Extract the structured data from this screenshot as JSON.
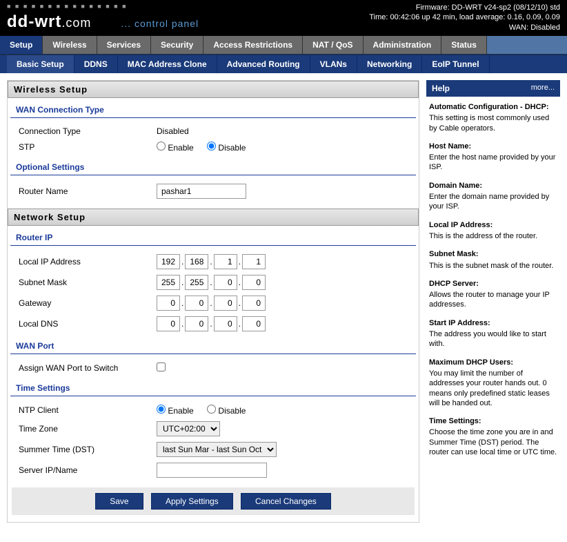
{
  "header": {
    "firmware": "Firmware: DD-WRT v24-sp2 (08/12/10) std",
    "time": "Time: 00:42:06 up 42 min, load average: 0.16, 0.09, 0.09",
    "wan": "WAN: Disabled",
    "logo_top": "■ ■ ■ ■ ■ ■ ■ ■ ■ ■ ■ ■ ■ ■ ■",
    "logo_main1": "dd-wrt",
    "logo_main2": ".com",
    "logo_sub": "... control panel"
  },
  "main_tabs": [
    "Setup",
    "Wireless",
    "Services",
    "Security",
    "Access Restrictions",
    "NAT / QoS",
    "Administration",
    "Status"
  ],
  "sub_tabs": [
    "Basic Setup",
    "DDNS",
    "MAC Address Clone",
    "Advanced Routing",
    "VLANs",
    "Networking",
    "EoIP Tunnel"
  ],
  "sections": {
    "wireless_setup": "Wireless Setup",
    "network_setup": "Network Setup"
  },
  "fieldsets": {
    "wan_connection_type": "WAN Connection Type",
    "optional_settings": "Optional Settings",
    "router_ip": "Router IP",
    "wan_port": "WAN Port",
    "time_settings": "Time Settings"
  },
  "labels": {
    "connection_type": "Connection Type",
    "connection_type_value": "Disabled",
    "stp": "STP",
    "enable": "Enable",
    "disable": "Disable",
    "router_name": "Router Name",
    "local_ip": "Local IP Address",
    "subnet_mask": "Subnet Mask",
    "gateway": "Gateway",
    "local_dns": "Local DNS",
    "assign_wan": "Assign WAN Port to Switch",
    "ntp_client": "NTP Client",
    "time_zone": "Time Zone",
    "summer_time": "Summer Time (DST)",
    "server_ip": "Server IP/Name"
  },
  "values": {
    "router_name": "pashar1",
    "local_ip": [
      "192",
      "168",
      "1",
      "1"
    ],
    "subnet_mask": [
      "255",
      "255",
      "0",
      "0"
    ],
    "gateway": [
      "0",
      "0",
      "0",
      "0"
    ],
    "local_dns": [
      "0",
      "0",
      "0",
      "0"
    ],
    "time_zone": "UTC+02:00",
    "summer_time": "last Sun Mar - last Sun Oct",
    "server_ip": ""
  },
  "buttons": {
    "save": "Save",
    "apply": "Apply Settings",
    "cancel": "Cancel Changes"
  },
  "help": {
    "title": "Help",
    "more": "more...",
    "items": [
      {
        "t": "Automatic Configuration - DHCP:",
        "d": "This setting is most commonly used by Cable operators."
      },
      {
        "t": "Host Name:",
        "d": "Enter the host name provided by your ISP."
      },
      {
        "t": "Domain Name:",
        "d": "Enter the domain name provided by your ISP."
      },
      {
        "t": "Local IP Address:",
        "d": "This is the address of the router."
      },
      {
        "t": "Subnet Mask:",
        "d": "This is the subnet mask of the router."
      },
      {
        "t": "DHCP Server:",
        "d": "Allows the router to manage your IP addresses."
      },
      {
        "t": "Start IP Address:",
        "d": "The address you would like to start with."
      },
      {
        "t": "Maximum DHCP Users:",
        "d": "You may limit the number of addresses your router hands out. 0 means only predefined static leases will be handed out."
      },
      {
        "t": "Time Settings:",
        "d": "Choose the time zone you are in and Summer Time (DST) period. The router can use local time or UTC time."
      }
    ]
  }
}
